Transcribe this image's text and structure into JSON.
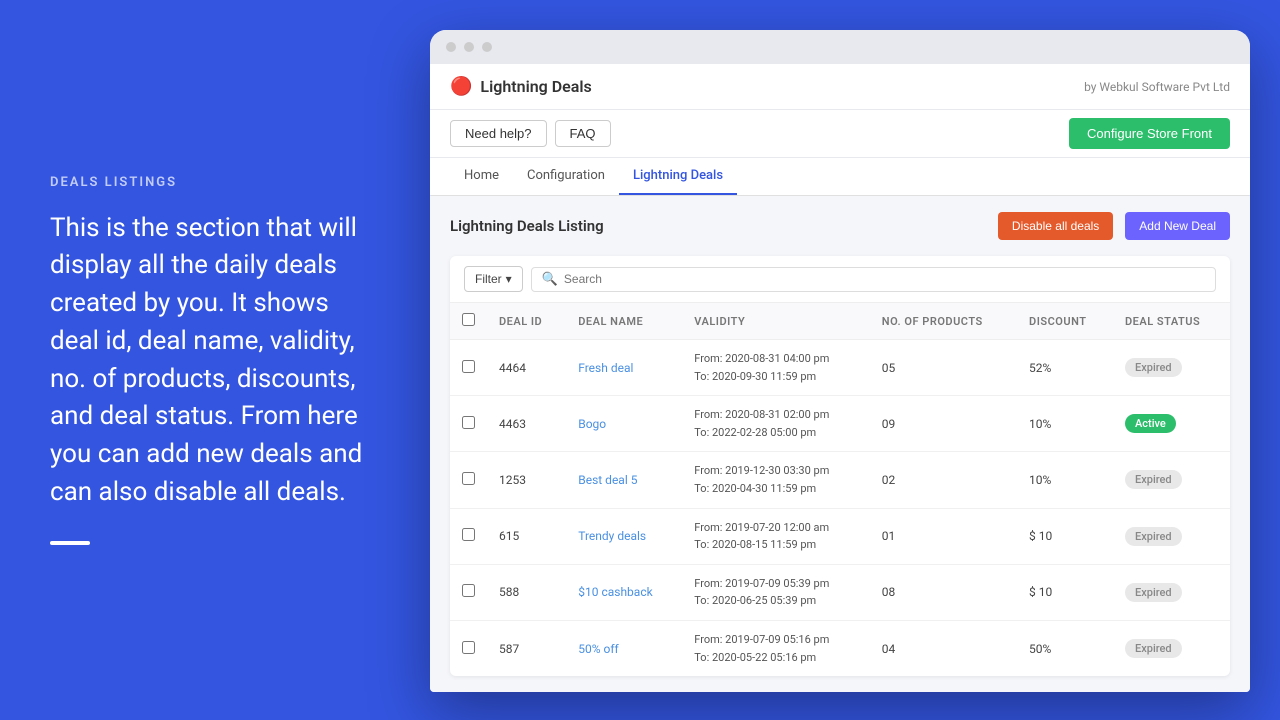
{
  "left": {
    "section_label": "DEALS LISTINGS",
    "section_text": "This is the section that will display all the daily deals created by you. It shows deal id, deal name, validity, no. of products, discounts, and deal status. From here you can add new deals and can also disable all deals."
  },
  "browser": {
    "app_icon": "🔴",
    "app_title": "Lightning Deals",
    "app_subtitle": "by Webkul Software Pvt Ltd",
    "buttons": {
      "need_help": "Need help?",
      "faq": "FAQ",
      "configure_store_front": "Configure Store Front"
    },
    "tabs": [
      {
        "label": "Home",
        "active": false
      },
      {
        "label": "Configuration",
        "active": false
      },
      {
        "label": "Lightning Deals",
        "active": true
      }
    ],
    "content": {
      "title": "Lightning Deals Listing",
      "disable_all_deals": "Disable all deals",
      "add_new_deal": "Add New Deal"
    },
    "table": {
      "toolbar": {
        "filter_label": "Filter",
        "search_placeholder": "Search"
      },
      "columns": [
        "DEAL ID",
        "DEAL NAME",
        "VALIDITY",
        "NO. OF PRODUCTS",
        "DISCOUNT",
        "DEAL STATUS"
      ],
      "rows": [
        {
          "id": "4464",
          "name": "Fresh deal",
          "validity_from": "From: 2020-08-31 04:00 pm",
          "validity_to": "To: 2020-09-30 11:59 pm",
          "products": "05",
          "discount": "52%",
          "status": "Expired",
          "status_type": "expired"
        },
        {
          "id": "4463",
          "name": "Bogo",
          "validity_from": "From: 2020-08-31 02:00 pm",
          "validity_to": "To: 2022-02-28 05:00 pm",
          "products": "09",
          "discount": "10%",
          "status": "Active",
          "status_type": "active"
        },
        {
          "id": "1253",
          "name": "Best deal 5",
          "validity_from": "From: 2019-12-30 03:30 pm",
          "validity_to": "To: 2020-04-30 11:59 pm",
          "products": "02",
          "discount": "10%",
          "status": "Expired",
          "status_type": "expired"
        },
        {
          "id": "615",
          "name": "Trendy deals",
          "validity_from": "From: 2019-07-20 12:00 am",
          "validity_to": "To: 2020-08-15 11:59 pm",
          "products": "01",
          "discount": "$ 10",
          "status": "Expired",
          "status_type": "expired"
        },
        {
          "id": "588",
          "name": "$10 cashback",
          "validity_from": "From: 2019-07-09 05:39 pm",
          "validity_to": "To: 2020-06-25 05:39 pm",
          "products": "08",
          "discount": "$ 10",
          "status": "Expired",
          "status_type": "expired"
        },
        {
          "id": "587",
          "name": "50% off",
          "validity_from": "From: 2019-07-09 05:16 pm",
          "validity_to": "To: 2020-05-22 05:16 pm",
          "products": "04",
          "discount": "50%",
          "status": "Expired",
          "status_type": "expired"
        }
      ]
    }
  }
}
